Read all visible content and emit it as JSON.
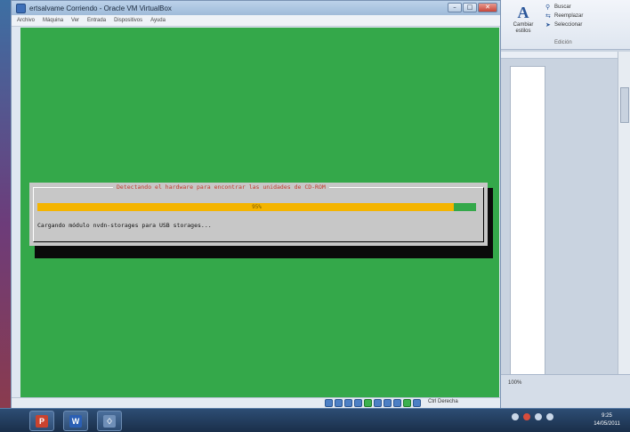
{
  "vbox": {
    "title": "ertsalvame Corriendo - Oracle VM VirtualBox",
    "menu": [
      "Archivo",
      "Máquina",
      "Ver",
      "Entrada",
      "Dispositivos",
      "Ayuda"
    ],
    "host_key": "Ctrl Derecha"
  },
  "installer": {
    "dialog_title": "Detectando el hardware para encontrar las unidades de CD-ROM",
    "progress_percent": 95,
    "progress_label": "95%",
    "status_text": "Cargando módulo nvdn-storages para USB storages..."
  },
  "word": {
    "ribbon_big_button": "Cambiar estilos",
    "ribbon_items": [
      "Buscar",
      "Reemplazar",
      "Seleccionar"
    ],
    "ribbon_group": "Edición",
    "zoom": "100%"
  },
  "taskbar": {
    "time": "9:25",
    "date": "14/05/2011"
  },
  "colors": {
    "vm_background": "#34a84a",
    "dialog": "#c7c7c7",
    "progress_fill": "#f4b400",
    "dialog_title_text": "#c0392b"
  }
}
